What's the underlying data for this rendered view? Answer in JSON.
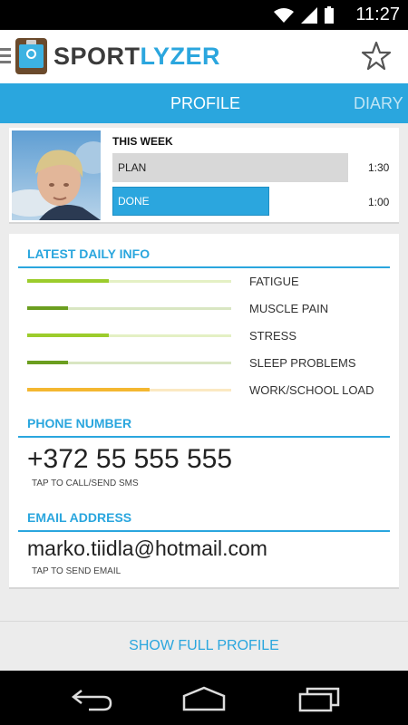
{
  "status_bar": {
    "time": "11:27"
  },
  "app": {
    "name_part1": "SPORT",
    "name_part2": "LYZER"
  },
  "icons": {
    "menu": "menu-icon",
    "logo": "stopwatch-clipboard-logo",
    "favorite": "star-icon",
    "wifi": "wifi-icon",
    "signal": "signal-icon",
    "battery": "battery-icon"
  },
  "tabs": [
    {
      "label": "PROFILE",
      "active": true
    },
    {
      "label": "DIARY",
      "active": false
    }
  ],
  "week": {
    "title": "THIS WEEK",
    "plan": {
      "label": "PLAN",
      "time": "1:30",
      "fraction": 1.0
    },
    "done": {
      "label": "DONE",
      "time": "1:00",
      "fraction": 0.667
    }
  },
  "daily_info": {
    "title": "LATEST DAILY INFO",
    "metrics": [
      {
        "label": "FATIGUE",
        "level": 0.4,
        "color": "#9ccc2c",
        "track": "#e4f0c4"
      },
      {
        "label": "MUSCLE PAIN",
        "level": 0.2,
        "color": "#6b9e1f",
        "track": "#d9e6c2"
      },
      {
        "label": "STRESS",
        "level": 0.4,
        "color": "#9ccc2c",
        "track": "#e4f0c4"
      },
      {
        "label": "SLEEP PROBLEMS",
        "level": 0.2,
        "color": "#6b9e1f",
        "track": "#d9e6c2"
      },
      {
        "label": "WORK/SCHOOL LOAD",
        "level": 0.6,
        "color": "#f4b731",
        "track": "#fbe9c2"
      }
    ]
  },
  "phone": {
    "title": "PHONE NUMBER",
    "value": "+372 55 555 555",
    "hint": "TAP TO CALL/SEND SMS"
  },
  "email": {
    "title": "EMAIL ADDRESS",
    "value": "marko.tiidla@hotmail.com",
    "hint": "TAP TO SEND EMAIL"
  },
  "footer": {
    "show_full": "SHOW FULL PROFILE"
  },
  "colors": {
    "accent": "#2aa6de",
    "plan_bar": "#d8d8d8",
    "done_bar": "#2ba6de"
  }
}
